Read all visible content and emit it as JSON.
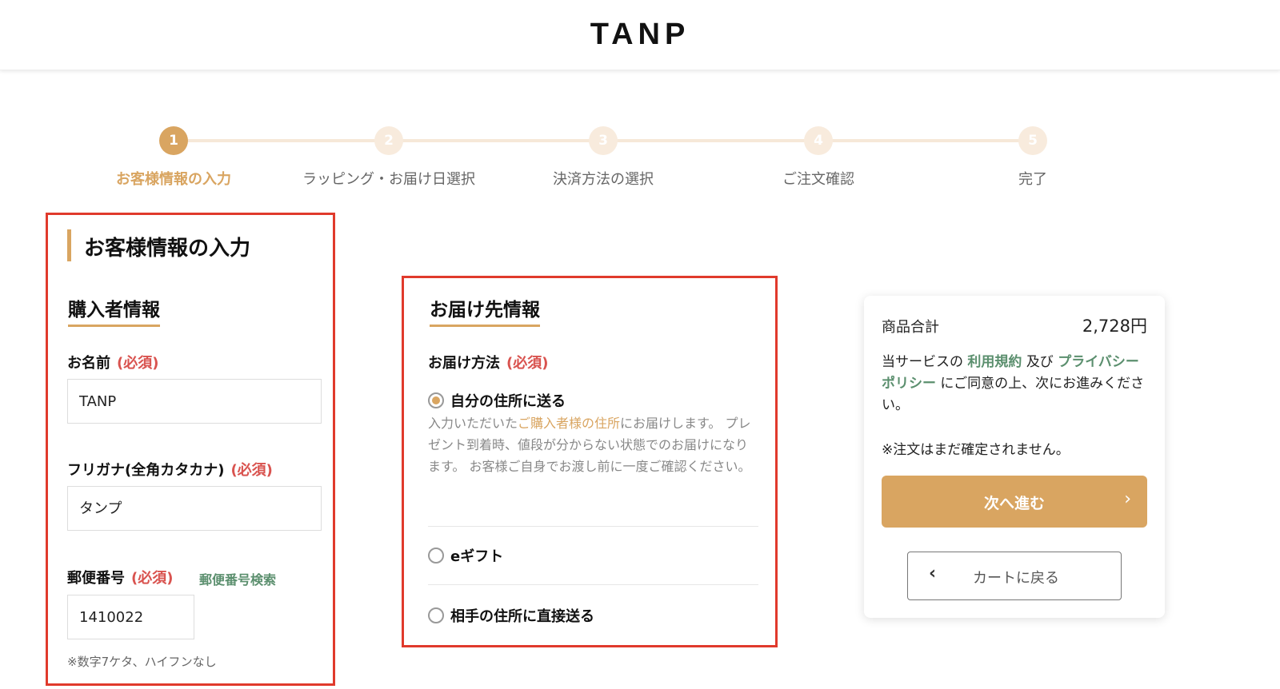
{
  "header": {
    "logo": "TANP"
  },
  "steps": [
    {
      "number": "1",
      "label": "お客様情報の入力",
      "active": true
    },
    {
      "number": "2",
      "label": "ラッピング・お届け日選択",
      "active": false
    },
    {
      "number": "3",
      "label": "決済方法の選択",
      "active": false
    },
    {
      "number": "4",
      "label": "ご注文確認",
      "active": false
    },
    {
      "number": "5",
      "label": "完了",
      "active": false
    }
  ],
  "customer": {
    "section_title": "お客様情報の入力",
    "subsection_title": "購入者情報",
    "name": {
      "label": "お名前",
      "required": "(必須)",
      "value": "TANP"
    },
    "kana": {
      "label": "フリガナ(全角カタカナ)",
      "required": "(必須)",
      "value": "タンプ"
    },
    "zip": {
      "label": "郵便番号",
      "required": "(必須)",
      "search_link": "郵便番号検索",
      "value": "1410022",
      "note": "※数字7ケタ、ハイフンなし"
    }
  },
  "delivery": {
    "subsection_title": "お届け先情報",
    "method": {
      "label": "お届け方法",
      "required": "(必須)"
    },
    "options": [
      {
        "label": "自分の住所に送る",
        "checked": true
      },
      {
        "label": "eギフト",
        "checked": false
      },
      {
        "label": "相手の住所に直接送る",
        "checked": false
      }
    ],
    "description": {
      "before": "入力いただいた",
      "highlight": "ご購入者様の住所",
      "after": "にお届けします。 プレゼント到着時、値段が分からない状態でのお届けになります。 お客様ご自身でお渡し前に一度ご確認ください。"
    }
  },
  "summary": {
    "total_label": "商品合計",
    "total_value": "2,728円",
    "agree_1": "当サービスの",
    "terms_link": "利用規約",
    "agree_2": "及び",
    "privacy_link": "プライバシーポリシー",
    "agree_3": "にご同意の上、次にお進みください。",
    "notice": "※注文はまだ確定されません。",
    "next_button": "次へ進む",
    "back_button": "カートに戻る"
  },
  "colors": {
    "accent": "#d9a561",
    "required": "#d9534f",
    "link": "#5b8f6e",
    "highlight_box": "#e03a2c"
  }
}
